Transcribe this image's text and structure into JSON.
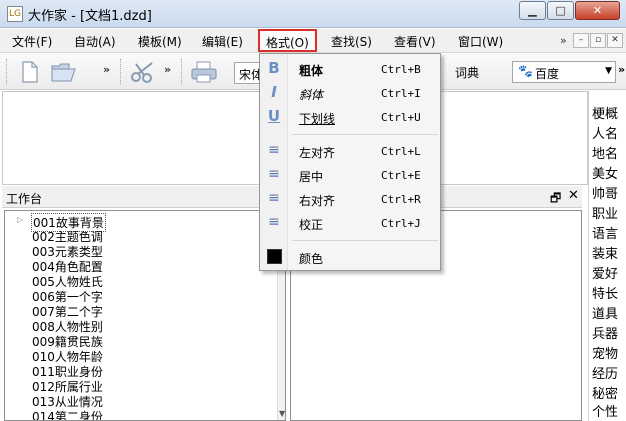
{
  "window": {
    "title": "大作家 - [文档1.dzd]",
    "app_icon_text": "LG",
    "minimize_label": "▁",
    "maximize_label": "□",
    "close_label": "✕"
  },
  "menubar": {
    "items": [
      {
        "label": "文件(F)"
      },
      {
        "label": "自动(A)"
      },
      {
        "label": "模板(M)"
      },
      {
        "label": "编辑(E)"
      },
      {
        "label": "格式(O)"
      },
      {
        "label": "查找(S)"
      },
      {
        "label": "查看(V)"
      },
      {
        "label": "窗口(W)"
      }
    ],
    "overflow": "»",
    "mdi_minimize": "–",
    "mdi_restore": "▫",
    "mdi_close": "✕"
  },
  "toolbar": {
    "chevron": "»",
    "font_name": "宋体",
    "dict_label": "词典",
    "search_engine": "百度",
    "search_arrow": "▼"
  },
  "format_menu": {
    "items": [
      {
        "label": "粗体",
        "shortcut": "Ctrl+B",
        "icon": "B"
      },
      {
        "label": "斜体",
        "shortcut": "Ctrl+I",
        "icon": "I"
      },
      {
        "label": "下划线",
        "shortcut": "Ctrl+U",
        "icon": "U"
      },
      {
        "label": "左对齐",
        "shortcut": "Ctrl+L",
        "icon": "≡"
      },
      {
        "label": "居中",
        "shortcut": "Ctrl+E",
        "icon": "≡"
      },
      {
        "label": "右对齐",
        "shortcut": "Ctrl+R",
        "icon": "≡"
      },
      {
        "label": "校正",
        "shortcut": "Ctrl+J",
        "icon": "≡"
      },
      {
        "label": "颜色",
        "shortcut": "",
        "icon": ""
      }
    ]
  },
  "workbench": {
    "title": "工作台",
    "pin": "🗗",
    "close": "✕",
    "expander": "▷",
    "tree_items": [
      "001故事背景",
      "002主题色调",
      "003元素类型",
      "004角色配置",
      "005人物姓氏",
      "006第一个字",
      "007第二个字",
      "008人物性别",
      "009籍贯民族",
      "010人物年龄",
      "011职业身份",
      "012所属行业",
      "013从业情况",
      "014第二身份"
    ],
    "scroll_down": "▼"
  },
  "wordlist": [
    "梗概",
    "人名",
    "地名",
    "美女",
    "帅哥",
    "职业",
    "语言",
    "装束",
    "爱好",
    "特长",
    "道具",
    "兵器",
    "宠物",
    "经历",
    "秘密",
    "个性"
  ],
  "colors": {
    "highlight_box": "#d9302c",
    "swatch": "#000000"
  }
}
